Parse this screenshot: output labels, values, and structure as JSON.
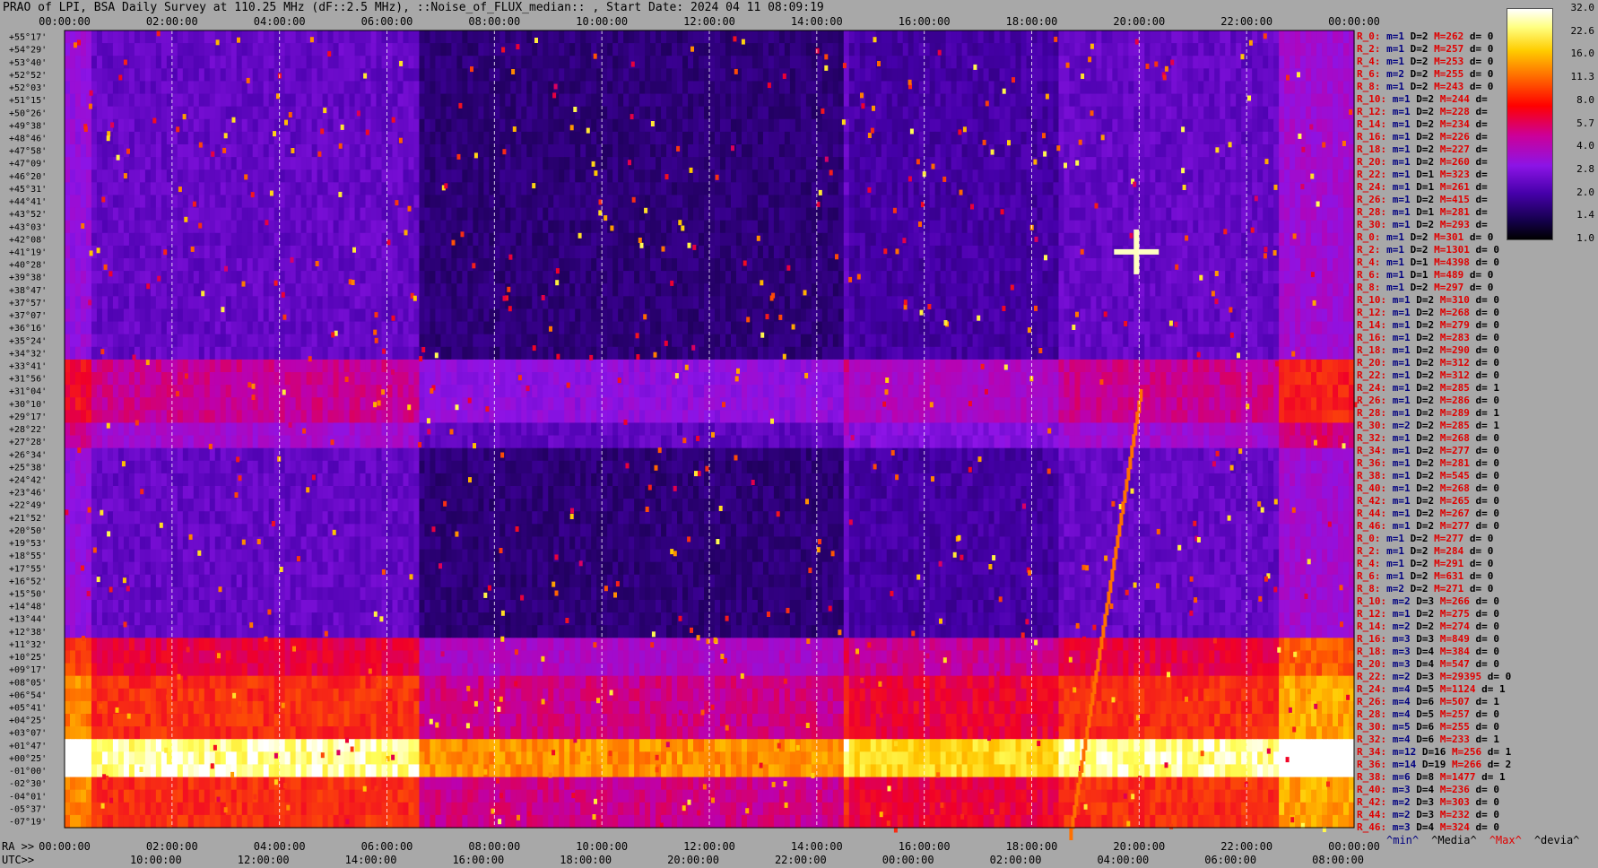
{
  "title": "PRAO of LPI, BSA Daily Survey at 110.25 MHz (dF::2.5 MHz), ::Noise_of_FLUX_median:: , Start Date: 2024 04 11 08:09:19",
  "chart_data": {
    "type": "heatmap",
    "title": "PRAO of LPI, BSA Daily Survey at 110.25 MHz (dF::2.5 MHz), ::Noise_of_FLUX_median:: , Start Date: 2024 04 11 08:09:19",
    "x_top_ticks": [
      "00:00:00",
      "02:00:00",
      "04:00:00",
      "06:00:00",
      "08:00:00",
      "10:00:00",
      "12:00:00",
      "14:00:00",
      "16:00:00",
      "18:00:00",
      "20:00:00",
      "22:00:00",
      "00:00:00"
    ],
    "x_ra_ticks": [
      "00:00:00",
      "02:00:00",
      "04:00:00",
      "06:00:00",
      "08:00:00",
      "10:00:00",
      "12:00:00",
      "14:00:00",
      "16:00:00",
      "18:00:00",
      "20:00:00",
      "22:00:00",
      "00:00:00"
    ],
    "x_utc_ticks": [
      "10:00:00",
      "12:00:00",
      "14:00:00",
      "16:00:00",
      "18:00:00",
      "20:00:00",
      "22:00:00",
      "00:00:00",
      "02:00:00",
      "04:00:00",
      "06:00:00",
      "08:00:00"
    ],
    "ra_prefix": "RA >>",
    "utc_prefix": "UTC>>",
    "declinations": [
      "+55°17'",
      "+54°29'",
      "+53°40'",
      "+52°52'",
      "+52°03'",
      "+51°15'",
      "+50°26'",
      "+49°38'",
      "+48°46'",
      "+47°58'",
      "+47°09'",
      "+46°20'",
      "+45°31'",
      "+44°41'",
      "+43°52'",
      "+43°03'",
      "+42°08'",
      "+41°19'",
      "+40°28'",
      "+39°38'",
      "+38°47'",
      "+37°57'",
      "+37°07'",
      "+36°16'",
      "+35°24'",
      "+34°32'",
      "+33°41'",
      "+31°56'",
      "+31°04'",
      "+30°10'",
      "+29°17'",
      "+28°22'",
      "+27°28'",
      "+26°34'",
      "+25°38'",
      "+24°42'",
      "+23°46'",
      "+22°49'",
      "+21°52'",
      "+20°50'",
      "+19°53'",
      "+18°55'",
      "+17°55'",
      "+16°52'",
      "+15°50'",
      "+14°48'",
      "+13°44'",
      "+12°38'",
      "+11°32'",
      "+10°25'",
      "+09°17'",
      "+08°05'",
      "+06°54'",
      "+05°41'",
      "+04°25'",
      "+03°07'",
      "+01°47'",
      "+00°25'",
      "-01°00'",
      "-02°30'",
      "-04°01'",
      "-05°37'",
      "-07°19'"
    ],
    "colorbar": {
      "ticks": [
        "32.0",
        "22.6",
        "16.0",
        "11.3",
        "8.0",
        "5.7",
        "4.0",
        "2.8",
        "2.0",
        "1.4",
        "1.0"
      ],
      "scale": "log",
      "range": [
        1.0,
        32.0
      ],
      "colormap": "gnuplot-like (black-blue-purple-red-orange-yellow-white)"
    },
    "annotations": [
      {
        "label": "bright horizontal band",
        "dec": "+00°25'"
      },
      {
        "label": "bright source",
        "ra": "19:58",
        "dec": "+41°19'"
      },
      {
        "label": "drifting arc",
        "ra_range": [
          "18:40",
          "20:00"
        ]
      }
    ]
  },
  "stats": [
    {
      "r": "R_0:",
      "m": "m=1",
      "d": "D=2",
      "M": "M=262",
      "dev": "d= 0"
    },
    {
      "r": "R_2:",
      "m": "m=1",
      "d": "D=2",
      "M": "M=257",
      "dev": "d= 0"
    },
    {
      "r": "R_4:",
      "m": "m=1",
      "d": "D=2",
      "M": "M=253",
      "dev": "d= 0"
    },
    {
      "r": "R_6:",
      "m": "m=2",
      "d": "D=2",
      "M": "M=255",
      "dev": "d= 0"
    },
    {
      "r": "R_8:",
      "m": "m=1",
      "d": "D=2",
      "M": "M=243",
      "dev": "d= 0"
    },
    {
      "r": "R_10:",
      "m": "m=1",
      "d": "D=2",
      "M": "M=244",
      "dev": "d="
    },
    {
      "r": "R_12:",
      "m": "m=1",
      "d": "D=2",
      "M": "M=228",
      "dev": "d="
    },
    {
      "r": "R_14:",
      "m": "m=1",
      "d": "D=2",
      "M": "M=234",
      "dev": "d="
    },
    {
      "r": "R_16:",
      "m": "m=1",
      "d": "D=2",
      "M": "M=226",
      "dev": "d="
    },
    {
      "r": "R_18:",
      "m": "m=1",
      "d": "D=2",
      "M": "M=227",
      "dev": "d="
    },
    {
      "r": "R_20:",
      "m": "m=1",
      "d": "D=2",
      "M": "M=260",
      "dev": "d="
    },
    {
      "r": "R_22:",
      "m": "m=1",
      "d": "D=1",
      "M": "M=323",
      "dev": "d="
    },
    {
      "r": "R_24:",
      "m": "m=1",
      "d": "D=1",
      "M": "M=261",
      "dev": "d="
    },
    {
      "r": "R_26:",
      "m": "m=1",
      "d": "D=2",
      "M": "M=415",
      "dev": "d="
    },
    {
      "r": "R_28:",
      "m": "m=1",
      "d": "D=1",
      "M": "M=281",
      "dev": "d="
    },
    {
      "r": "R_30:",
      "m": "m=1",
      "d": "D=2",
      "M": "M=293",
      "dev": "d="
    },
    {
      "r": "R_0:",
      "m": "m=1",
      "d": "D=2",
      "M": "M=301",
      "dev": "d= 0"
    },
    {
      "r": "R_2:",
      "m": "m=1",
      "d": "D=2",
      "M": "M=1301",
      "dev": "d= 0"
    },
    {
      "r": "R_4:",
      "m": "m=1",
      "d": "D=1",
      "M": "M=4398",
      "dev": "d= 0"
    },
    {
      "r": "R_6:",
      "m": "m=1",
      "d": "D=1",
      "M": "M=489",
      "dev": "d= 0"
    },
    {
      "r": "R_8:",
      "m": "m=1",
      "d": "D=2",
      "M": "M=297",
      "dev": "d= 0"
    },
    {
      "r": "R_10:",
      "m": "m=1",
      "d": "D=2",
      "M": "M=310",
      "dev": "d= 0"
    },
    {
      "r": "R_12:",
      "m": "m=1",
      "d": "D=2",
      "M": "M=268",
      "dev": "d= 0"
    },
    {
      "r": "R_14:",
      "m": "m=1",
      "d": "D=2",
      "M": "M=279",
      "dev": "d= 0"
    },
    {
      "r": "R_16:",
      "m": "m=1",
      "d": "D=2",
      "M": "M=283",
      "dev": "d= 0"
    },
    {
      "r": "R_18:",
      "m": "m=1",
      "d": "D=2",
      "M": "M=290",
      "dev": "d= 0"
    },
    {
      "r": "R_20:",
      "m": "m=1",
      "d": "D=2",
      "M": "M=312",
      "dev": "d= 0"
    },
    {
      "r": "R_22:",
      "m": "m=1",
      "d": "D=2",
      "M": "M=312",
      "dev": "d= 0"
    },
    {
      "r": "R_24:",
      "m": "m=1",
      "d": "D=2",
      "M": "M=285",
      "dev": "d= 1"
    },
    {
      "r": "R_26:",
      "m": "m=1",
      "d": "D=2",
      "M": "M=286",
      "dev": "d= 0"
    },
    {
      "r": "R_28:",
      "m": "m=1",
      "d": "D=2",
      "M": "M=289",
      "dev": "d= 1"
    },
    {
      "r": "R_30:",
      "m": "m=2",
      "d": "D=2",
      "M": "M=285",
      "dev": "d= 1"
    },
    {
      "r": "R_32:",
      "m": "m=1",
      "d": "D=2",
      "M": "M=268",
      "dev": "d= 0"
    },
    {
      "r": "R_34:",
      "m": "m=1",
      "d": "D=2",
      "M": "M=277",
      "dev": "d= 0"
    },
    {
      "r": "R_36:",
      "m": "m=1",
      "d": "D=2",
      "M": "M=281",
      "dev": "d= 0"
    },
    {
      "r": "R_38:",
      "m": "m=1",
      "d": "D=2",
      "M": "M=545",
      "dev": "d= 0"
    },
    {
      "r": "R_40:",
      "m": "m=1",
      "d": "D=2",
      "M": "M=268",
      "dev": "d= 0"
    },
    {
      "r": "R_42:",
      "m": "m=1",
      "d": "D=2",
      "M": "M=265",
      "dev": "d= 0"
    },
    {
      "r": "R_44:",
      "m": "m=1",
      "d": "D=2",
      "M": "M=267",
      "dev": "d= 0"
    },
    {
      "r": "R_46:",
      "m": "m=1",
      "d": "D=2",
      "M": "M=277",
      "dev": "d= 0"
    },
    {
      "r": "R_0:",
      "m": "m=1",
      "d": "D=2",
      "M": "M=277",
      "dev": "d= 0"
    },
    {
      "r": "R_2:",
      "m": "m=1",
      "d": "D=2",
      "M": "M=284",
      "dev": "d= 0"
    },
    {
      "r": "R_4:",
      "m": "m=1",
      "d": "D=2",
      "M": "M=291",
      "dev": "d= 0"
    },
    {
      "r": "R_6:",
      "m": "m=1",
      "d": "D=2",
      "M": "M=631",
      "dev": "d= 0"
    },
    {
      "r": "R_8:",
      "m": "m=2",
      "d": "D=2",
      "M": "M=271",
      "dev": "d= 0"
    },
    {
      "r": "R_10:",
      "m": "m=2",
      "d": "D=3",
      "M": "M=266",
      "dev": "d= 0"
    },
    {
      "r": "R_12:",
      "m": "m=1",
      "d": "D=2",
      "M": "M=275",
      "dev": "d= 0"
    },
    {
      "r": "R_14:",
      "m": "m=2",
      "d": "D=2",
      "M": "M=274",
      "dev": "d= 0"
    },
    {
      "r": "R_16:",
      "m": "m=3",
      "d": "D=3",
      "M": "M=849",
      "dev": "d= 0"
    },
    {
      "r": "R_18:",
      "m": "m=3",
      "d": "D=4",
      "M": "M=384",
      "dev": "d= 0"
    },
    {
      "r": "R_20:",
      "m": "m=3",
      "d": "D=4",
      "M": "M=547",
      "dev": "d= 0"
    },
    {
      "r": "R_22:",
      "m": "m=2",
      "d": "D=3",
      "M": "M=29395",
      "dev": "d= 0"
    },
    {
      "r": "R_24:",
      "m": "m=4",
      "d": "D=5",
      "M": "M=1124",
      "dev": "d= 1"
    },
    {
      "r": "R_26:",
      "m": "m=4",
      "d": "D=6",
      "M": "M=507",
      "dev": "d= 1"
    },
    {
      "r": "R_28:",
      "m": "m=4",
      "d": "D=5",
      "M": "M=257",
      "dev": "d= 0"
    },
    {
      "r": "R_30:",
      "m": "m=5",
      "d": "D=6",
      "M": "M=255",
      "dev": "d= 0"
    },
    {
      "r": "R_32:",
      "m": "m=4",
      "d": "D=6",
      "M": "M=233",
      "dev": "d= 1"
    },
    {
      "r": "R_34:",
      "m": "m=12",
      "d": "D=16",
      "M": "M=256",
      "dev": "d= 1"
    },
    {
      "r": "R_36:",
      "m": "m=14",
      "d": "D=19",
      "M": "M=266",
      "dev": "d= 2"
    },
    {
      "r": "R_38:",
      "m": "m=6",
      "d": "D=8",
      "M": "M=1477",
      "dev": "d= 1"
    },
    {
      "r": "R_40:",
      "m": "m=3",
      "d": "D=4",
      "M": "M=236",
      "dev": "d= 0"
    },
    {
      "r": "R_42:",
      "m": "m=2",
      "d": "D=3",
      "M": "M=303",
      "dev": "d= 0"
    },
    {
      "r": "R_44:",
      "m": "m=2",
      "d": "D=3",
      "M": "M=232",
      "dev": "d= 0"
    },
    {
      "r": "R_46:",
      "m": "m=3",
      "d": "D=4",
      "M": "M=324",
      "dev": "d= 0"
    }
  ],
  "legend": {
    "min": "^min^",
    "median": "^Media^",
    "max": "^Max^",
    "deviation": "^devia^"
  }
}
